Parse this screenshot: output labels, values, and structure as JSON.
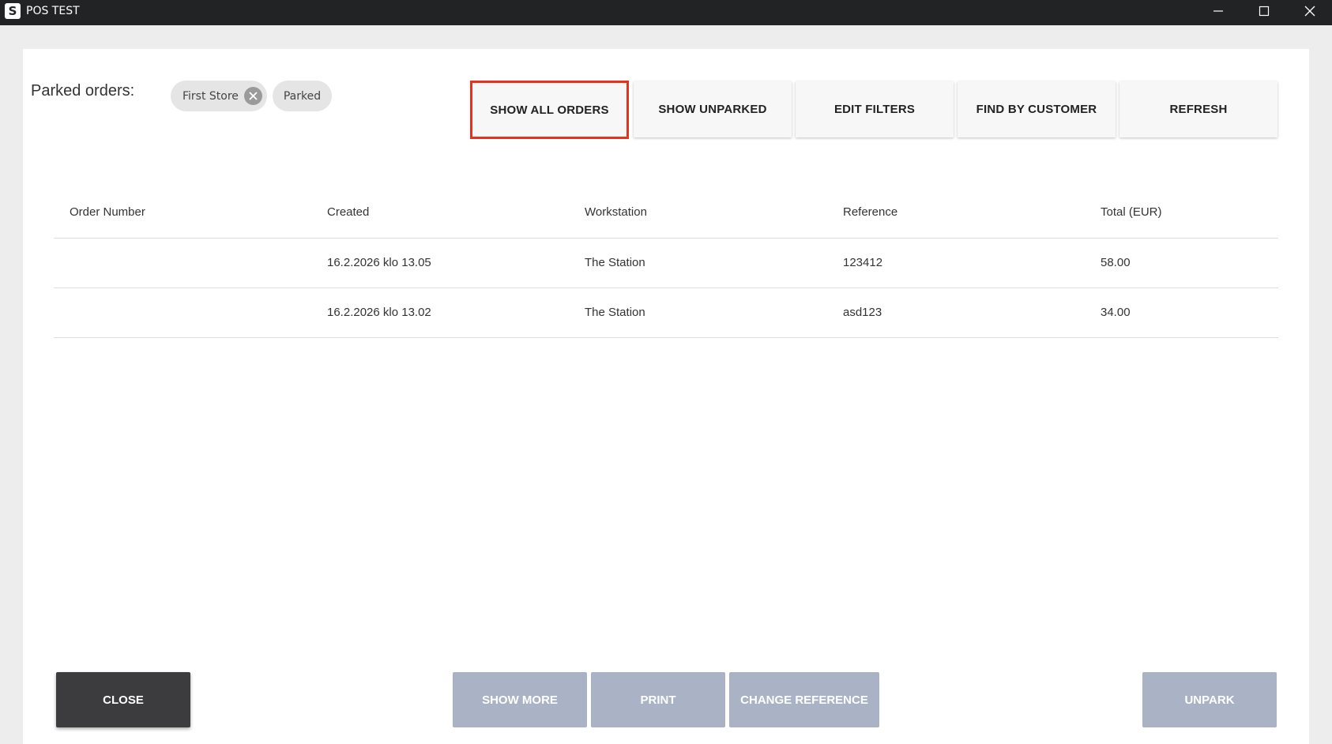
{
  "window": {
    "logo_letter": "S",
    "title": "POS TEST"
  },
  "filters": {
    "label": "Parked orders:",
    "chips": [
      {
        "label": "First Store",
        "removable": true
      },
      {
        "label": "Parked",
        "removable": false
      }
    ]
  },
  "toolbar": {
    "show_all_orders": "SHOW ALL ORDERS",
    "show_unparked": "SHOW UNPARKED",
    "edit_filters": "EDIT FILTERS",
    "find_by_customer": "FIND BY CUSTOMER",
    "refresh": "REFRESH",
    "highlight_color": "#e8301c"
  },
  "table": {
    "columns": [
      "Order Number",
      "Created",
      "Workstation",
      "Reference",
      "Total (EUR)"
    ],
    "rows": [
      {
        "order_number": "",
        "created": "16.2.2026 klo 13.05",
        "workstation": "The Station",
        "reference": "123412",
        "total": "58.00"
      },
      {
        "order_number": "",
        "created": "16.2.2026 klo 13.02",
        "workstation": "The Station",
        "reference": "asd123",
        "total": "34.00"
      }
    ]
  },
  "actions": {
    "close": "CLOSE",
    "show_more": "SHOW MORE",
    "print": "PRINT",
    "change_reference": "CHANGE REFERENCE",
    "unpark": "UNPARK",
    "disabled_color": "#a9b3c5",
    "close_color": "#3c3c3e"
  },
  "icons": {
    "minimize": "minimize-icon",
    "maximize": "maximize-icon",
    "close": "close-icon",
    "chip_remove": "remove-chip-icon"
  }
}
